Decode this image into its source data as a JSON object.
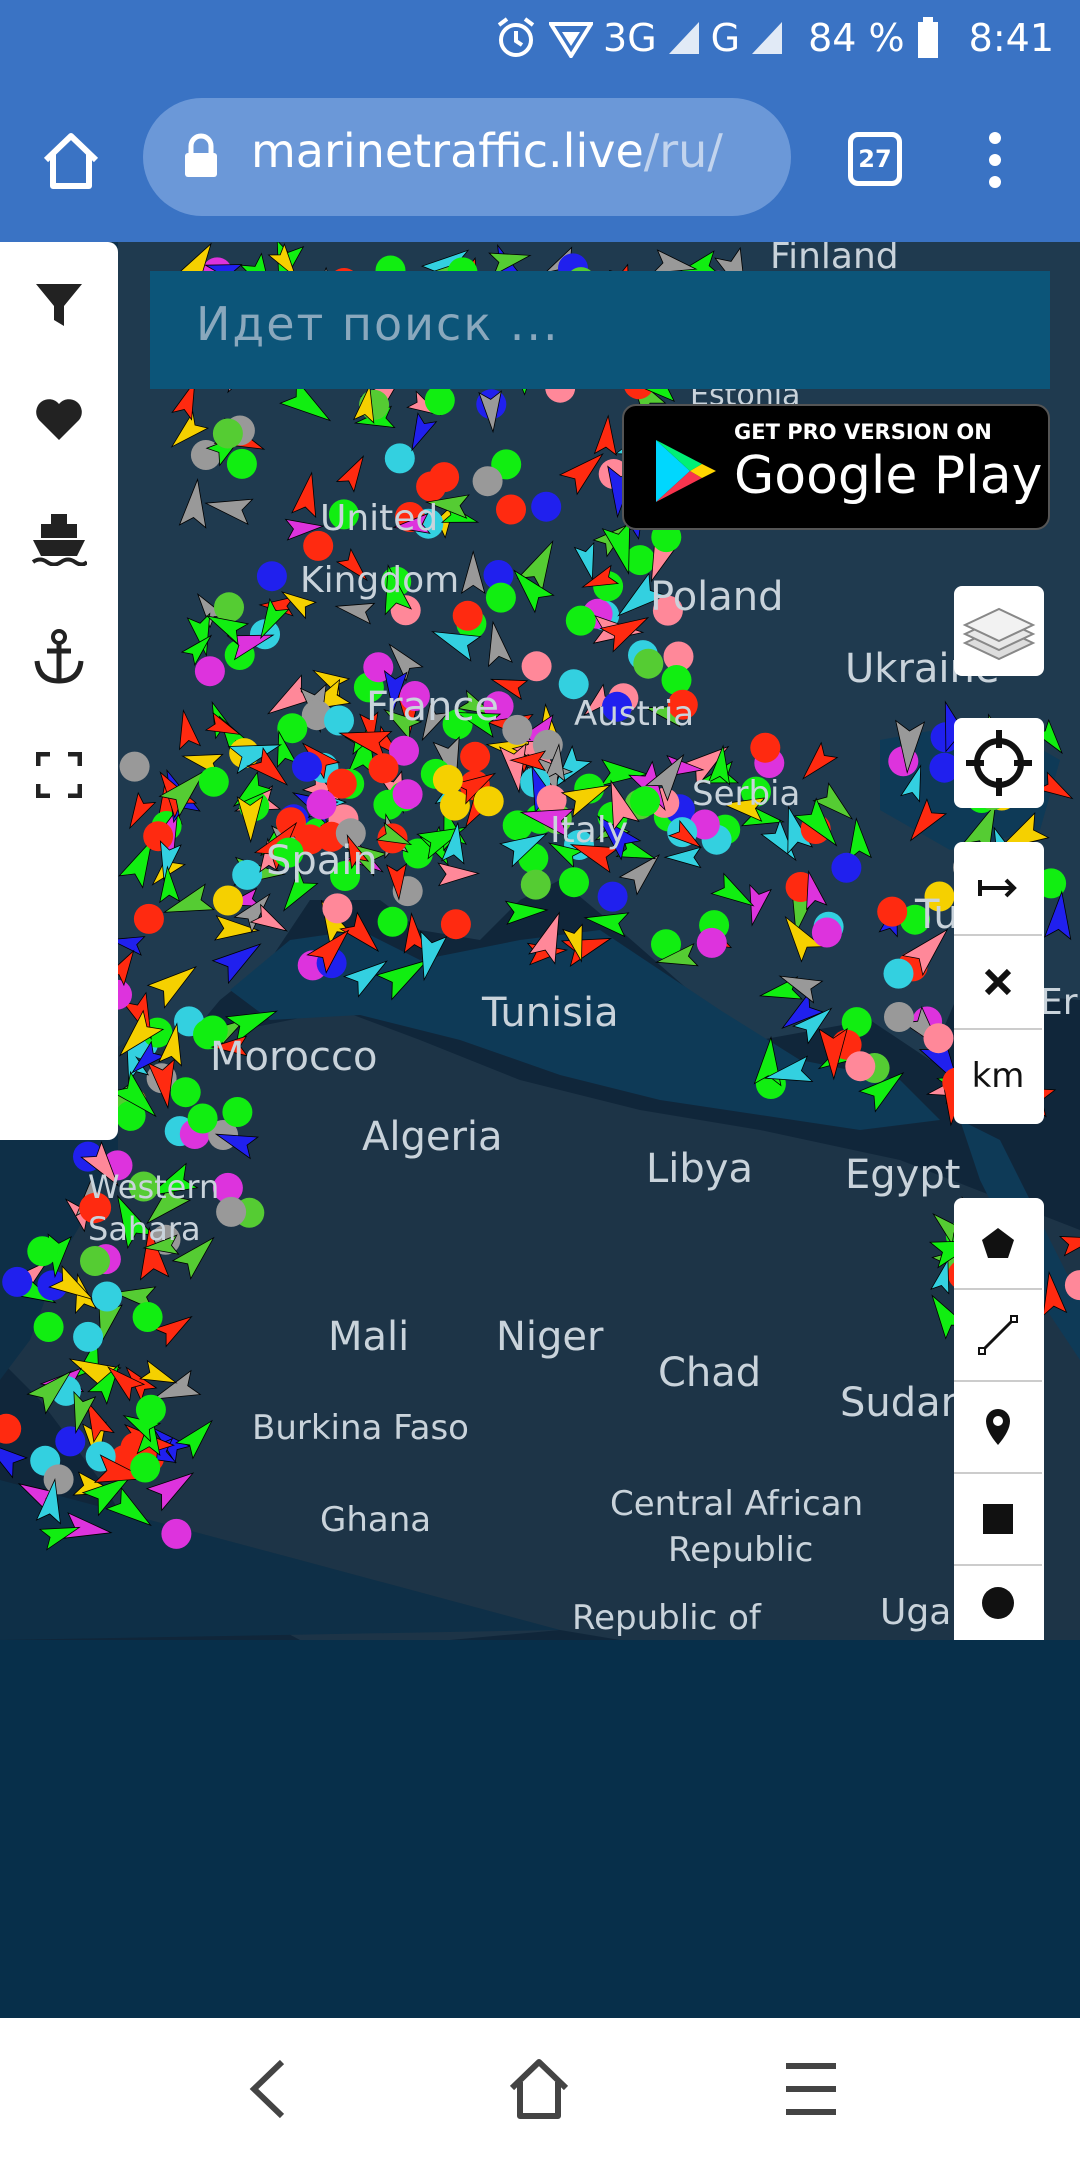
{
  "status_bar": {
    "network_3g": "3G",
    "network_g": "G",
    "battery": "84 %",
    "time": "8:41"
  },
  "browser": {
    "url_host": "marinetraffic.live",
    "url_path": "/ru/",
    "tab_count": "27"
  },
  "search": {
    "placeholder": "Идет поиск ..."
  },
  "promo": {
    "line1": "GET PRO VERSION ON",
    "line2": "Google Play"
  },
  "controls": {
    "scale_unit": "km"
  },
  "map_labels": [
    {
      "text": "Finland",
      "size": 36
    },
    {
      "text": "Estonia",
      "size": 30
    },
    {
      "text": "Poland",
      "size": 40
    },
    {
      "text": "Ukraine",
      "size": 40
    },
    {
      "text": "France",
      "size": 40
    },
    {
      "text": "Austria",
      "size": 34
    },
    {
      "text": "Serbia",
      "size": 34
    },
    {
      "text": "Spain",
      "size": 40
    },
    {
      "text": "Italy",
      "size": 36
    },
    {
      "text": "Turkey",
      "size": 40
    },
    {
      "text": "Tunisia",
      "size": 40
    },
    {
      "text": "Morocco",
      "size": 40
    },
    {
      "text": "Algeria",
      "size": 40
    },
    {
      "text": "Libya",
      "size": 40
    },
    {
      "text": "Egypt",
      "size": 40
    },
    {
      "text": "Western",
      "size": 32
    },
    {
      "text": "Sahara",
      "size": 32
    },
    {
      "text": "Mali",
      "size": 40
    },
    {
      "text": "Niger",
      "size": 40
    },
    {
      "text": "Chad",
      "size": 40
    },
    {
      "text": "Sudan",
      "size": 40
    },
    {
      "text": "Burkina Faso",
      "size": 34
    },
    {
      "text": "Ghana",
      "size": 34
    },
    {
      "text": "Central African",
      "size": 34
    },
    {
      "text": "Republic",
      "size": 34
    },
    {
      "text": "Republic of",
      "size": 34
    },
    {
      "text": "Uganda",
      "size": 36
    },
    {
      "text": "Kingdom",
      "size": 36
    },
    {
      "text": "United",
      "size": 36
    },
    {
      "text": "Eritrea",
      "size": 36
    }
  ]
}
